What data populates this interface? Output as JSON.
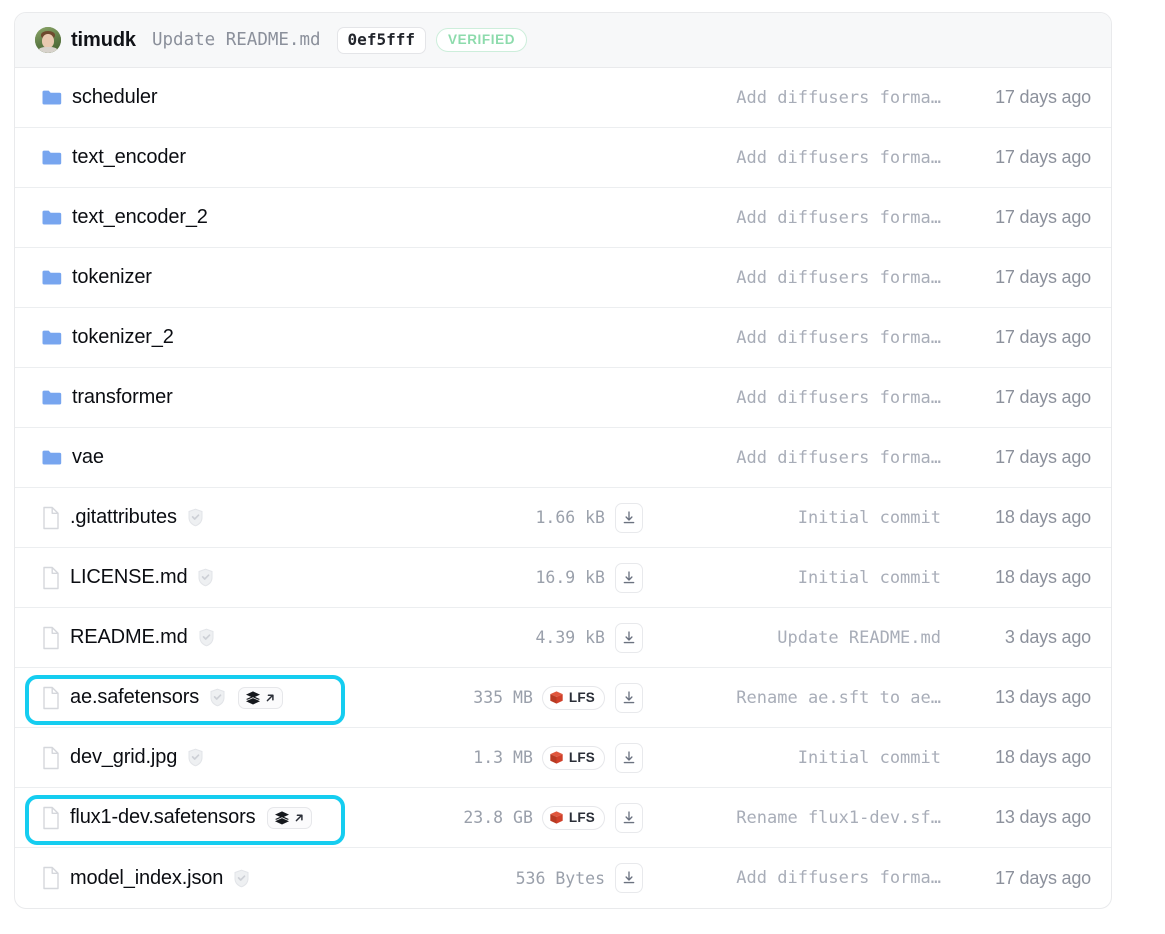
{
  "header": {
    "author": "timudk",
    "commit_title": "Update README.md",
    "commit_hash": "0ef5fff",
    "verified_label": "VERIFIED",
    "avatar_name": "avatar"
  },
  "badges": {
    "lfs_label": "LFS",
    "safetensors_badge_name": "safetensors-viewer-badge",
    "download_name": "download-button"
  },
  "colors": {
    "highlight": "#15cdf0",
    "folder": "#77a5ef",
    "lfs_red": "#d0402a",
    "verified_green": "#8ddbac"
  },
  "rows": [
    {
      "type": "folder",
      "name": "scheduler",
      "size": "",
      "lfs": false,
      "download": false,
      "shield": false,
      "safetensors": false,
      "commit": "Add diffusers forma…",
      "date": "17 days ago",
      "highlighted": false
    },
    {
      "type": "folder",
      "name": "text_encoder",
      "size": "",
      "lfs": false,
      "download": false,
      "shield": false,
      "safetensors": false,
      "commit": "Add diffusers forma…",
      "date": "17 days ago",
      "highlighted": false
    },
    {
      "type": "folder",
      "name": "text_encoder_2",
      "size": "",
      "lfs": false,
      "download": false,
      "shield": false,
      "safetensors": false,
      "commit": "Add diffusers forma…",
      "date": "17 days ago",
      "highlighted": false
    },
    {
      "type": "folder",
      "name": "tokenizer",
      "size": "",
      "lfs": false,
      "download": false,
      "shield": false,
      "safetensors": false,
      "commit": "Add diffusers forma…",
      "date": "17 days ago",
      "highlighted": false
    },
    {
      "type": "folder",
      "name": "tokenizer_2",
      "size": "",
      "lfs": false,
      "download": false,
      "shield": false,
      "safetensors": false,
      "commit": "Add diffusers forma…",
      "date": "17 days ago",
      "highlighted": false
    },
    {
      "type": "folder",
      "name": "transformer",
      "size": "",
      "lfs": false,
      "download": false,
      "shield": false,
      "safetensors": false,
      "commit": "Add diffusers forma…",
      "date": "17 days ago",
      "highlighted": false
    },
    {
      "type": "folder",
      "name": "vae",
      "size": "",
      "lfs": false,
      "download": false,
      "shield": false,
      "safetensors": false,
      "commit": "Add diffusers forma…",
      "date": "17 days ago",
      "highlighted": false
    },
    {
      "type": "file",
      "name": ".gitattributes",
      "size": "1.66 kB",
      "lfs": false,
      "download": true,
      "shield": true,
      "safetensors": false,
      "commit": "Initial commit",
      "date": "18 days ago",
      "highlighted": false
    },
    {
      "type": "file",
      "name": "LICENSE.md",
      "size": "16.9 kB",
      "lfs": false,
      "download": true,
      "shield": true,
      "safetensors": false,
      "commit": "Initial commit",
      "date": "18 days ago",
      "highlighted": false
    },
    {
      "type": "file",
      "name": "README.md",
      "size": "4.39 kB",
      "lfs": false,
      "download": true,
      "shield": true,
      "safetensors": false,
      "commit": "Update README.md",
      "date": "3 days ago",
      "highlighted": false
    },
    {
      "type": "file",
      "name": "ae.safetensors",
      "size": "335 MB",
      "lfs": true,
      "download": true,
      "shield": true,
      "safetensors": true,
      "commit": "Rename ae.sft to ae…",
      "date": "13 days ago",
      "highlighted": true
    },
    {
      "type": "file",
      "name": "dev_grid.jpg",
      "size": "1.3 MB",
      "lfs": true,
      "download": true,
      "shield": true,
      "safetensors": false,
      "commit": "Initial commit",
      "date": "18 days ago",
      "highlighted": false
    },
    {
      "type": "file",
      "name": "flux1-dev.safetensors",
      "size": "23.8 GB",
      "lfs": true,
      "download": true,
      "shield": false,
      "safetensors": true,
      "commit": "Rename flux1-dev.sf…",
      "date": "13 days ago",
      "highlighted": true
    },
    {
      "type": "file",
      "name": "model_index.json",
      "size": "536 Bytes",
      "lfs": false,
      "download": true,
      "shield": true,
      "safetensors": false,
      "commit": "Add diffusers forma…",
      "date": "17 days ago",
      "highlighted": false
    }
  ]
}
